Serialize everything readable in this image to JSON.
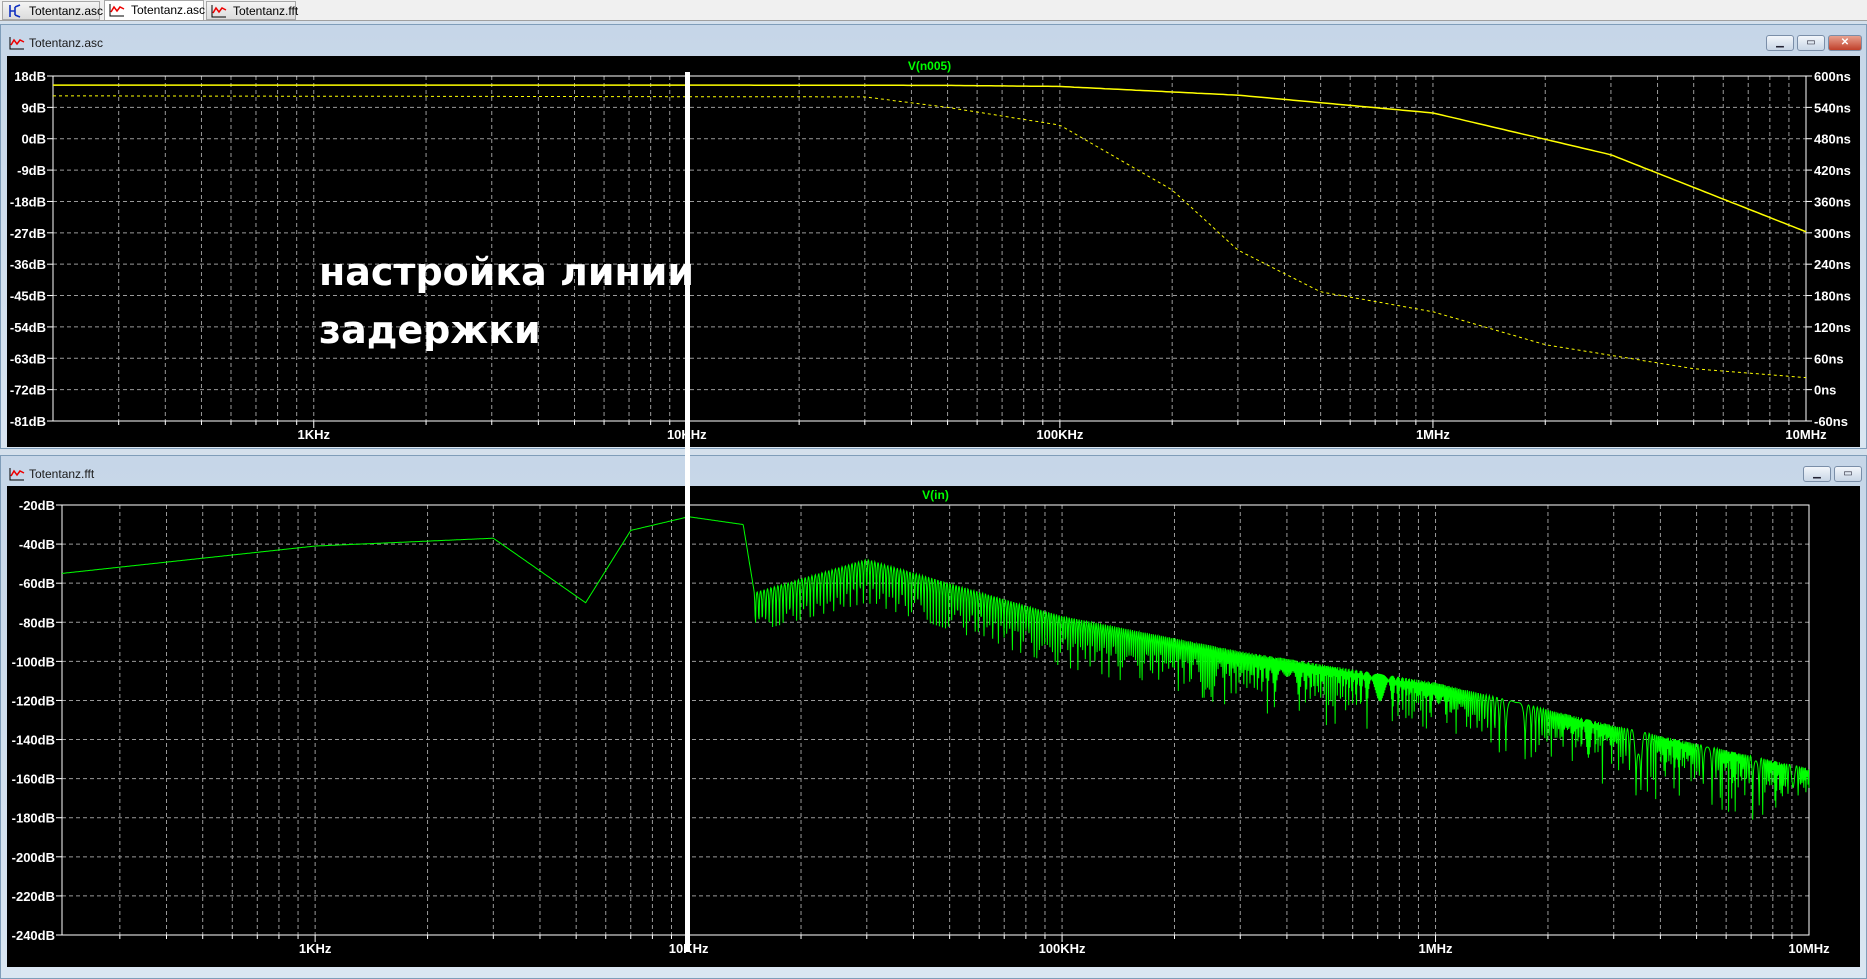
{
  "tabs": [
    {
      "label": "Totentanz.asc",
      "icon": "schematic-icon",
      "active": false
    },
    {
      "label": "Totentanz.asc",
      "icon": "waveform-icon",
      "active": true
    },
    {
      "label": "Totentanz.fft",
      "icon": "waveform-icon",
      "active": false
    }
  ],
  "window1": {
    "title": "Totentanz.asc",
    "buttons": {
      "minimize": "▁",
      "restore": "▭",
      "close": "✕"
    }
  },
  "window2": {
    "title": "Totentanz.fft",
    "buttons": {
      "minimize": "▁",
      "restore": "▭"
    }
  },
  "annotation": {
    "line1": "настройка линии",
    "line2": "задержки",
    "line_color": "#ffffff"
  },
  "chart_data": [
    {
      "type": "line",
      "title": "V(n005)",
      "x_scale": "log",
      "xlim": [
        200,
        10000000
      ],
      "x_ticks": [
        {
          "value": 1000,
          "label": "1KHz"
        },
        {
          "value": 10000,
          "label": "10KHz"
        },
        {
          "value": 100000,
          "label": "100KHz"
        },
        {
          "value": 1000000,
          "label": "1MHz"
        },
        {
          "value": 10000000,
          "label": "10MHz"
        }
      ],
      "ylim": [
        -81,
        18
      ],
      "y_ticks": [
        "18dB",
        "9dB",
        "0dB",
        "-9dB",
        "-18dB",
        "-27dB",
        "-36dB",
        "-45dB",
        "-54dB",
        "-63dB",
        "-72dB",
        "-81dB"
      ],
      "y2lim": [
        -60,
        600
      ],
      "y2_ticks": [
        "600ns",
        "540ns",
        "480ns",
        "420ns",
        "360ns",
        "300ns",
        "240ns",
        "180ns",
        "120ns",
        "60ns",
        "0ns",
        "-60ns"
      ],
      "grid": true,
      "color": "#ffff00",
      "title_color": "#00ff00",
      "series": [
        {
          "style": "solid",
          "axis": "left",
          "x": [
            200,
            10000,
            50000,
            100000,
            300000,
            1000000,
            3000000,
            10000000
          ],
          "y": [
            15.4,
            15.4,
            15.3,
            15,
            12.5,
            7.4,
            -4.6,
            -26.7
          ]
        },
        {
          "style": "dashed",
          "axis": "right",
          "x": [
            200,
            30000,
            50000,
            100000,
            200000,
            300000,
            500000,
            1000000,
            2000000,
            5000000,
            10000000
          ],
          "y": [
            562,
            560,
            540,
            506,
            382,
            267,
            187,
            149,
            86,
            40,
            23
          ]
        }
      ]
    },
    {
      "type": "line",
      "title": "V(in)",
      "x_scale": "log",
      "xlim": [
        210,
        10000000
      ],
      "x_ticks": [
        {
          "value": 1000,
          "label": "1KHz"
        },
        {
          "value": 10000,
          "label": "10KHz"
        },
        {
          "value": 100000,
          "label": "100KHz"
        },
        {
          "value": 1000000,
          "label": "1MHz"
        },
        {
          "value": 10000000,
          "label": "10MHz"
        }
      ],
      "ylim": [
        -240,
        -20
      ],
      "y_ticks": [
        "-20dB",
        "-40dB",
        "-60dB",
        "-80dB",
        "-100dB",
        "-120dB",
        "-140dB",
        "-160dB",
        "-180dB",
        "-200dB",
        "-220dB",
        "-240dB"
      ],
      "grid": true,
      "color": "#00ff00",
      "title_color": "#00ff00",
      "series": [
        {
          "style": "solid",
          "axis": "left",
          "envelope_x": [
            210,
            1000,
            3000,
            5300,
            7000,
            10000,
            14000,
            15000,
            30000,
            100000,
            300000,
            1000000,
            3000000,
            10000000
          ],
          "envelope_y": [
            -55,
            -41,
            -37,
            -70,
            -33,
            -26,
            -30,
            -65,
            -48,
            -77,
            -95,
            -111,
            -133,
            -155
          ],
          "lower_y_at_10MHz": -195
        }
      ]
    }
  ]
}
